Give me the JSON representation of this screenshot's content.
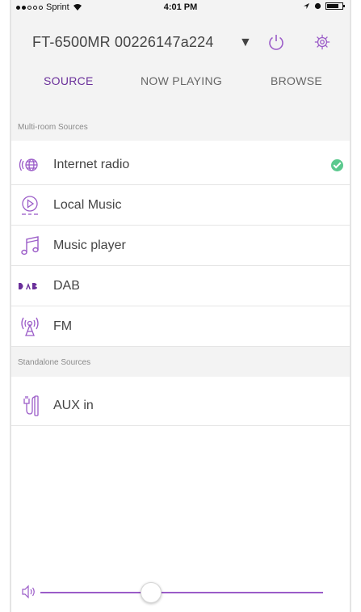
{
  "status_bar": {
    "carrier": "Sprint",
    "time": "4:01 PM",
    "signal_bars_filled": 2,
    "signal_bars_total": 5,
    "battery_fill_fraction": 0.8
  },
  "header": {
    "device_name": "FT-6500MR 00226147a224",
    "caret": "▼"
  },
  "tabs": [
    {
      "label": "SOURCE",
      "active": true
    },
    {
      "label": "NOW PLAYING",
      "active": false
    },
    {
      "label": "BROWSE",
      "active": false
    }
  ],
  "sections": {
    "multiroom": "Multi-room Sources",
    "standalone": "Standalone Sources"
  },
  "sources": {
    "internet_radio": {
      "label": "Internet radio",
      "icon": "globe-radio-icon",
      "selected": true
    },
    "local_music": {
      "label": "Local Music",
      "icon": "play-circle-icon"
    },
    "music_player": {
      "label": "Music player",
      "icon": "music-note-icon"
    },
    "dab": {
      "label": "DAB",
      "icon": "dab-logo-icon"
    },
    "fm": {
      "label": "FM",
      "icon": "fm-antenna-icon"
    },
    "aux": {
      "label": "AUX in",
      "icon": "aux-plug-icon"
    }
  },
  "volume": {
    "level_fraction": 0.39
  },
  "colors": {
    "accent": "#6a2f9a",
    "accent_light": "#9b5cc8",
    "selected_check": "#5bc98e",
    "header_bg": "#f3f3f3"
  }
}
